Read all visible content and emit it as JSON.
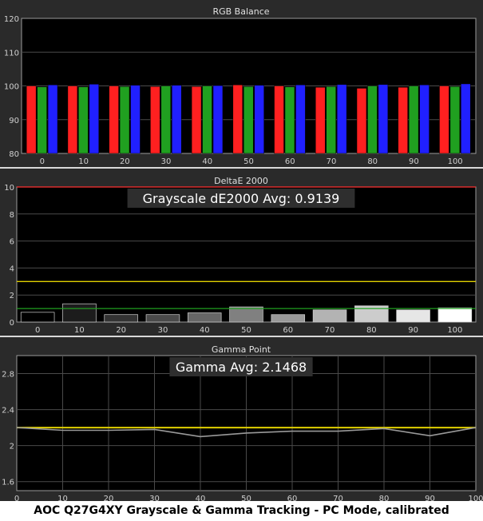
{
  "caption": "AOC Q27G4XY Grayscale & Gamma Tracking - PC Mode, calibrated",
  "chart_data": [
    {
      "type": "bar",
      "title": "RGB Balance",
      "categories": [
        "0",
        "10",
        "20",
        "30",
        "40",
        "50",
        "60",
        "70",
        "80",
        "90",
        "100"
      ],
      "ylim": [
        80,
        120
      ],
      "yticks": [
        "80",
        "90",
        "100",
        "110",
        "120"
      ],
      "grid": true,
      "series": [
        {
          "color": "#ff2020",
          "values": [
            100.0,
            100.0,
            100.0,
            99.8,
            99.8,
            100.3,
            100.0,
            99.6,
            99.3,
            99.6,
            100.0
          ]
        },
        {
          "color": "#20a020",
          "values": [
            99.7,
            99.7,
            99.8,
            100.0,
            100.0,
            99.8,
            99.7,
            99.8,
            100.0,
            100.0,
            99.8
          ]
        },
        {
          "color": "#2020ff",
          "values": [
            100.3,
            100.5,
            100.2,
            100.2,
            100.1,
            100.2,
            100.3,
            100.4,
            100.4,
            100.3,
            100.6
          ]
        }
      ]
    },
    {
      "type": "bar",
      "title": "DeltaE 2000",
      "annotation": "Grayscale dE2000 Avg: 0.9139",
      "categories": [
        "0",
        "10",
        "20",
        "30",
        "40",
        "50",
        "60",
        "70",
        "80",
        "90",
        "100"
      ],
      "ylim": [
        0,
        10
      ],
      "yticks": [
        "0",
        "2",
        "4",
        "6",
        "8",
        "10"
      ],
      "values": [
        0.72,
        1.35,
        0.55,
        0.55,
        0.68,
        1.12,
        0.55,
        0.9,
        1.2,
        0.9,
        1.05
      ],
      "bar_colors": [
        "#000000",
        "#1c1c1c",
        "#333333",
        "#4a4a4a",
        "#666666",
        "#808080",
        "#999999",
        "#b3b3b3",
        "#cccccc",
        "#e6e6e6",
        "#ffffff"
      ],
      "reference_lines": [
        {
          "value": 10,
          "color": "#ff3030"
        },
        {
          "value": 3,
          "color": "#e0d000"
        },
        {
          "value": 1,
          "color": "#20a020"
        }
      ]
    },
    {
      "type": "line",
      "title": "Gamma Point",
      "annotation": "Gamma Avg: 2.1468",
      "x": [
        0,
        10,
        20,
        30,
        40,
        50,
        60,
        70,
        80,
        90,
        100
      ],
      "xticks": [
        "0",
        "10",
        "20",
        "30",
        "40",
        "50",
        "60",
        "70",
        "80",
        "90",
        "100"
      ],
      "ylim": [
        1.5,
        3.0
      ],
      "yticks": [
        "1.6",
        "2",
        "2.4",
        "2.8"
      ],
      "series": [
        {
          "color": "#999999",
          "values": [
            2.2,
            2.17,
            2.17,
            2.18,
            2.1,
            2.14,
            2.16,
            2.16,
            2.19,
            2.11,
            2.2
          ]
        }
      ],
      "target": {
        "value": 2.2,
        "color": "#e0d000"
      }
    }
  ]
}
